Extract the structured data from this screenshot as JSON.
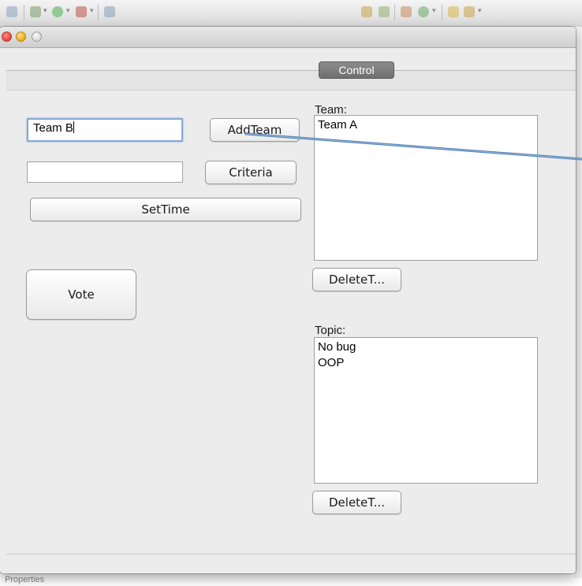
{
  "tab": {
    "label": "Control"
  },
  "inputs": {
    "team_name_value": "Team B",
    "criteria_value": ""
  },
  "buttons": {
    "add_team": "AddTeam",
    "criteria": "Criteria",
    "set_time": "SetTime",
    "vote": "Vote",
    "delete_team": "DeleteT...",
    "delete_topic": "DeleteT..."
  },
  "team_panel": {
    "label": "Team:",
    "items": [
      "Team A"
    ]
  },
  "topic_panel": {
    "label": "Topic:",
    "items": [
      "No bug",
      "OOP"
    ]
  },
  "background": {
    "bottom_text": "Properties"
  },
  "colors": {
    "annotation_arrow": "#4a7db5",
    "tab_background": "#7a7a7a",
    "focus_ring": "#85a9d8"
  }
}
